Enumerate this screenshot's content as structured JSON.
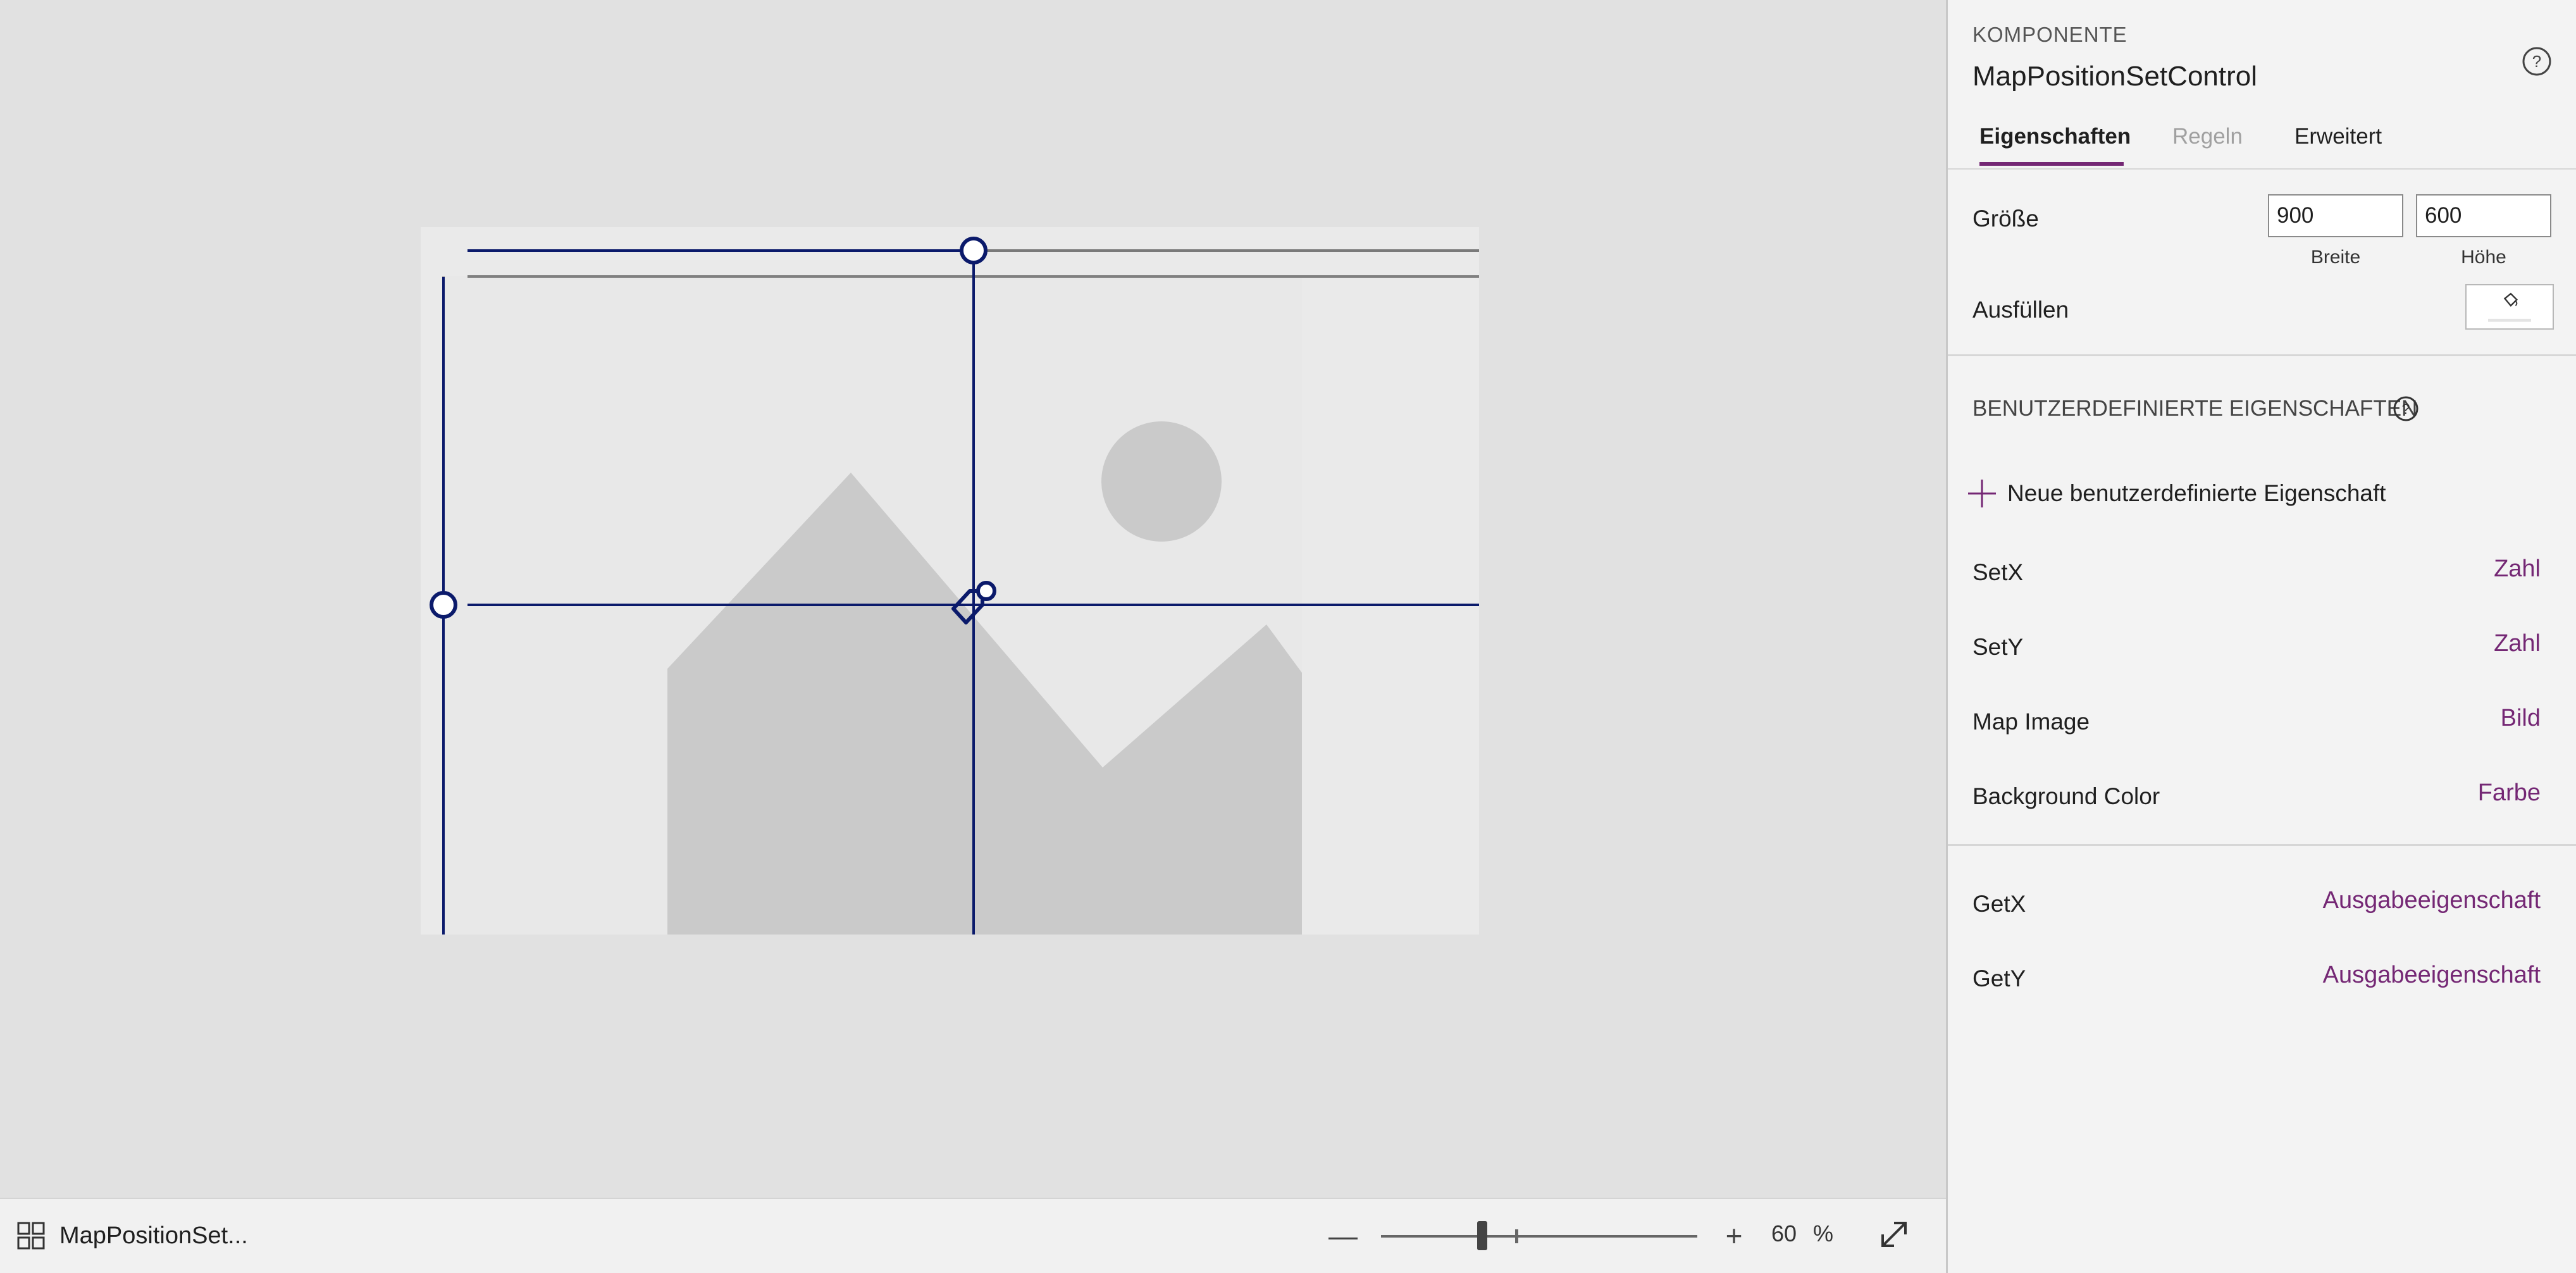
{
  "canvas": {
    "component_label": "MapPositionSet..."
  },
  "zoom": {
    "minus": "—",
    "plus": "+",
    "value": "60",
    "unit": "%",
    "slider_level_percent": 30
  },
  "pane": {
    "kind": "KOMPONENTE",
    "title": "MapPositionSetControl",
    "tabs": {
      "properties": "Eigenschaften",
      "rules": "Regeln",
      "advanced": "Erweitert"
    },
    "size": {
      "label": "Größe",
      "width_value": "900",
      "height_value": "600",
      "width_label": "Breite",
      "height_label": "Höhe"
    },
    "fill": {
      "label": "Ausfüllen"
    },
    "custom_section": {
      "heading": "BENUTZERDEFINIERTE EIGENSCHAFTEN",
      "new_property": "Neue benutzerdefinierte Eigenschaft"
    },
    "input_properties": [
      {
        "name": "SetX",
        "type": "Zahl"
      },
      {
        "name": "SetY",
        "type": "Zahl"
      },
      {
        "name": "Map Image",
        "type": "Bild"
      },
      {
        "name": "Background Color",
        "type": "Farbe"
      }
    ],
    "output_properties": [
      {
        "name": "GetX",
        "type": "Ausgabeeigenschaft"
      },
      {
        "name": "GetY",
        "type": "Ausgabeeigenschaft"
      }
    ]
  },
  "colors": {
    "accent": "#742774",
    "crosshair": "#0b1a6b",
    "canvas_bg": "#e1e1e1",
    "image_placeholder": "#cacaca"
  }
}
